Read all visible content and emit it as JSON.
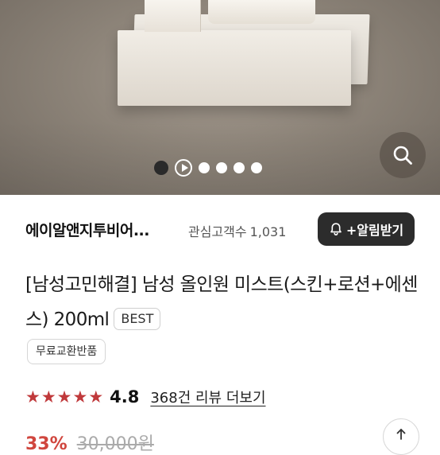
{
  "hero": {
    "carousel_total_dots": 6,
    "carousel_active_index": 0,
    "zoom_icon": "search-icon"
  },
  "store": {
    "name": "에이알앤지투비어...",
    "followers_label": "관심고객수",
    "followers_count": "1,031",
    "alarm_label": "+알림받기",
    "alarm_icon": "bell-icon"
  },
  "product": {
    "title": "[남성고민해결] 남성 올인원 미스트(스킨+로션+에센스) 200ml",
    "badge": "BEST",
    "tag": "무료교환반품",
    "rating": 4.8,
    "rating_display": "4.8",
    "star_color": "#c0393b",
    "review_link": "368건 리뷰 더보기",
    "discount": "33%",
    "original_price": "30,000원",
    "share_icon": "share-icon"
  }
}
